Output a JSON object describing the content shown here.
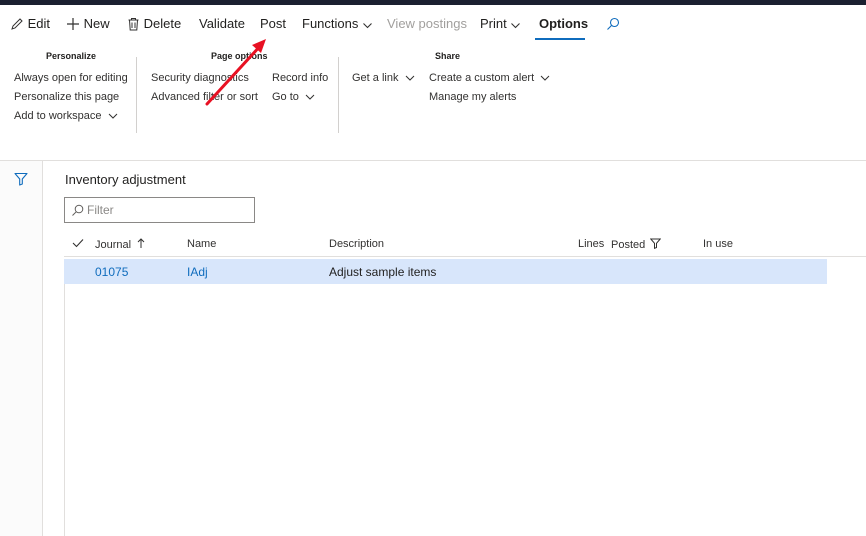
{
  "action_pane": {
    "edit": "Edit",
    "new": "New",
    "delete": "Delete",
    "validate": "Validate",
    "post": "Post",
    "functions": "Functions",
    "view_postings": "View postings",
    "print": "Print",
    "options": "Options"
  },
  "ribbon": {
    "personalize": {
      "title": "Personalize",
      "items": [
        "Always open for editing",
        "Personalize this page",
        "Add to workspace"
      ]
    },
    "page_options": {
      "title": "Page options",
      "items": [
        "Security diagnostics",
        "Advanced filter or sort",
        "Record info",
        "Go to"
      ]
    },
    "share": {
      "title": "Share",
      "items": [
        "Get a link",
        "Create a custom alert",
        "Manage my alerts"
      ]
    }
  },
  "content": {
    "title": "Inventory adjustment",
    "filter_placeholder": "Filter"
  },
  "grid": {
    "columns": [
      "Journal",
      "Name",
      "Description",
      "Lines",
      "Posted",
      "In use"
    ],
    "rows": [
      {
        "journal": "01075",
        "name": "IAdj",
        "description": "Adjust sample items",
        "lines": "",
        "posted": "",
        "in_use": ""
      }
    ]
  },
  "colors": {
    "accent": "#0f6cbd",
    "selected_row": "#d8e6fb",
    "annotation_arrow": "#e81123"
  }
}
